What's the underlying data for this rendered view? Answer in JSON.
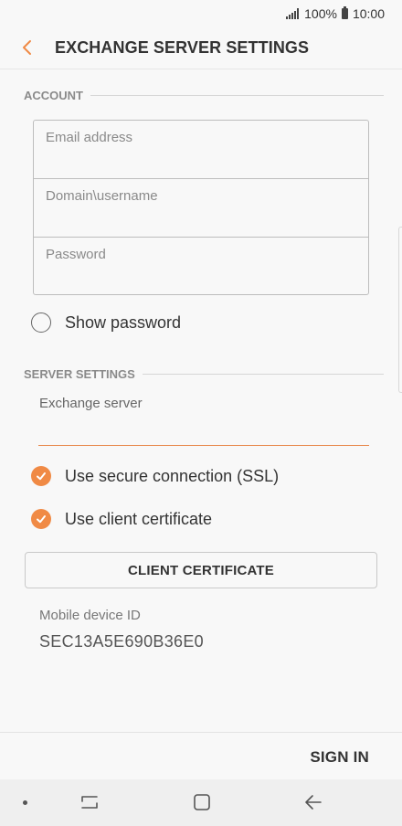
{
  "status_bar": {
    "battery_percent": "100%",
    "time": "10:00",
    "icons": [
      "signal-icon",
      "battery-icon"
    ]
  },
  "header": {
    "title": "EXCHANGE SERVER SETTINGS",
    "back_icon": "back-arrow-icon"
  },
  "account": {
    "section_title": "ACCOUNT",
    "fields": [
      {
        "placeholder": "Email address",
        "value": ""
      },
      {
        "placeholder": "Domain\\username",
        "value": ""
      },
      {
        "placeholder": "Password",
        "value": ""
      }
    ],
    "show_password": {
      "label": "Show password",
      "checked": false
    }
  },
  "server_settings": {
    "section_title": "SERVER SETTINGS",
    "exchange_server": {
      "label": "Exchange server",
      "value": ""
    },
    "ssl": {
      "label": "Use secure connection (SSL)",
      "checked": true
    },
    "client_cert": {
      "label": "Use client certificate",
      "checked": true
    },
    "client_cert_button": "CLIENT CERTIFICATE",
    "device_id_label": "Mobile device ID",
    "device_id_value": "SEC13A5E690B36E0"
  },
  "bottom": {
    "sign_in_label": "SIGN IN"
  },
  "nav_bar": {
    "icons": [
      "nav-dot-icon",
      "recent-apps-icon",
      "home-icon",
      "back-icon"
    ]
  },
  "colors": {
    "accent": "#f08a45",
    "background": "#f8f8f8",
    "text": "#333333"
  }
}
